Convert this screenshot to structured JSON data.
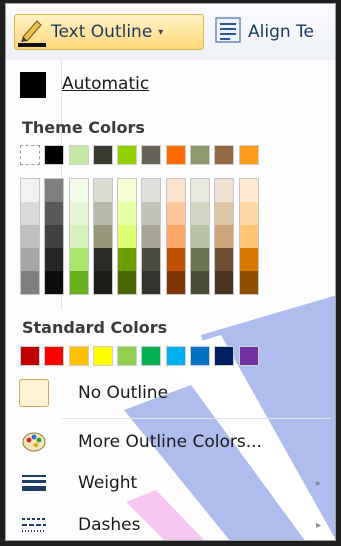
{
  "toolbar": {
    "text_outline_label": "Text Outline",
    "caret": "▾",
    "align_label": "Align Te"
  },
  "menu": {
    "automatic_label": "Automatic",
    "theme_colors_heading": "Theme Colors",
    "standard_colors_heading": "Standard Colors",
    "no_outline_label": "No Outline",
    "more_colors_label": "More Outline Colors...",
    "weight_label": "Weight",
    "dashes_label": "Dashes",
    "submenu_arrow": "▸"
  },
  "theme_colors": [
    "#ffffff",
    "#000000",
    "#c3e9a0",
    "#3a3a31",
    "#92d100",
    "#666458",
    "#ff6b00",
    "#8e9a6a",
    "#946a42",
    "#ff9c1c"
  ],
  "theme_shades": [
    [
      "#f2f2f2",
      "#d9d9d9",
      "#bfbfbf",
      "#a6a6a6",
      "#7f7f7f"
    ],
    [
      "#7f7f7f",
      "#595959",
      "#404040",
      "#262626",
      "#0d0d0d"
    ],
    [
      "#f2fbe9",
      "#e4f6d3",
      "#d7f2bd",
      "#a8e76c",
      "#67b11f"
    ],
    [
      "#dcdcd3",
      "#b9b9a7",
      "#979779",
      "#2b2b25",
      "#1d1d18"
    ],
    [
      "#f3ffd0",
      "#e8ffa2",
      "#dcff74",
      "#6e9d00",
      "#496900"
    ],
    [
      "#e1e0dc",
      "#c3c2b9",
      "#a5a496",
      "#4c4b42",
      "#33322c"
    ],
    [
      "#ffe2cc",
      "#ffc499",
      "#ffa766",
      "#bf5000",
      "#803500"
    ],
    [
      "#e8ebe1",
      "#d2d7c3",
      "#bbc3a5",
      "#6a7450",
      "#474d35"
    ],
    [
      "#efe1d2",
      "#dfc3a5",
      "#cfa57a",
      "#6f4f31",
      "#4a3521"
    ],
    [
      "#ffebd2",
      "#ffd7a4",
      "#ffc476",
      "#d97800",
      "#904f00"
    ]
  ],
  "standard_colors": [
    "#c00000",
    "#ff0000",
    "#ffc000",
    "#ffff00",
    "#92d050",
    "#00b050",
    "#00b0f0",
    "#0070c0",
    "#002060",
    "#7030a0"
  ],
  "colors": {
    "accent_border": "#e0b44e",
    "decoration_blue": "#aebdee",
    "decoration_pink": "#f7c6f0"
  },
  "icons": [
    "pencil-icon",
    "align-text-icon",
    "palette-icon",
    "weight-lines-icon",
    "dashes-lines-icon"
  ]
}
